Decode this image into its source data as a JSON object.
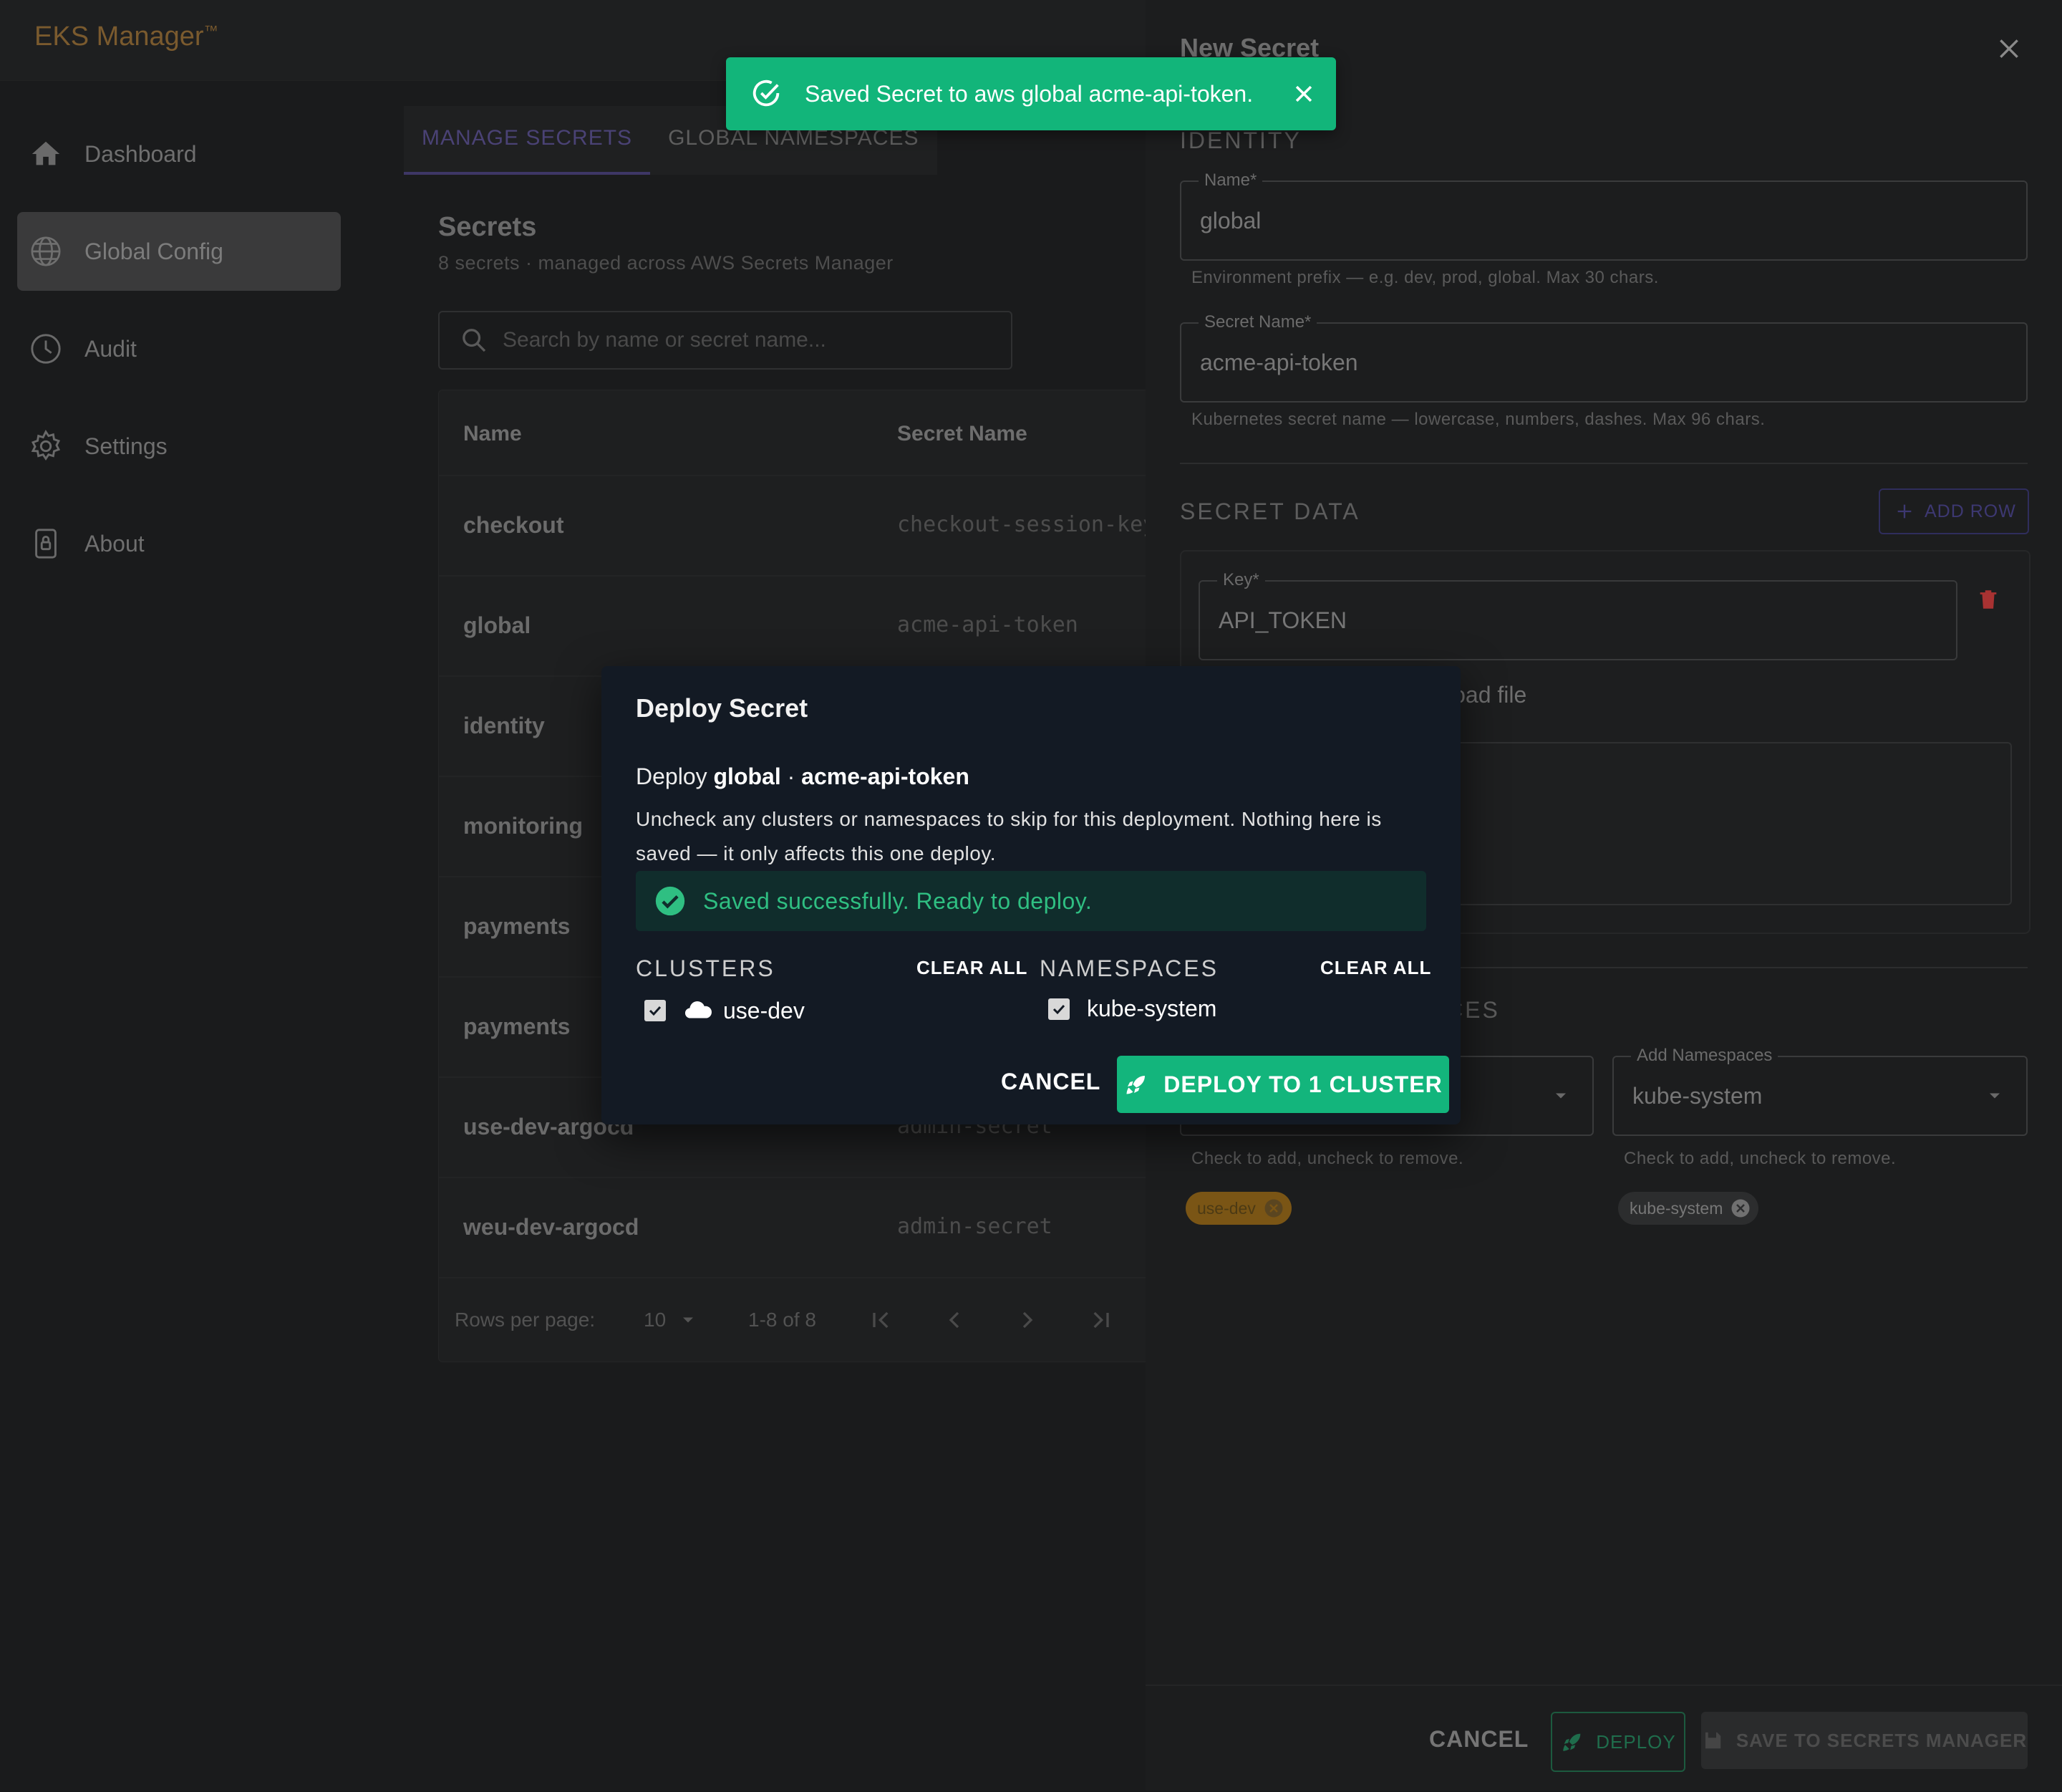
{
  "app": {
    "brand": "EKS Manager",
    "brand_mark": "™"
  },
  "sidebar": {
    "items": [
      {
        "label": "Dashboard",
        "icon": "home-icon"
      },
      {
        "label": "Global Config",
        "icon": "globe-icon",
        "active": true
      },
      {
        "label": "Audit",
        "icon": "clock-icon"
      },
      {
        "label": "Settings",
        "icon": "gear-icon"
      },
      {
        "label": "About",
        "icon": "lock-icon"
      }
    ]
  },
  "tabs": [
    {
      "label": "MANAGE SECRETS",
      "active": true
    },
    {
      "label": "GLOBAL NAMESPACES"
    }
  ],
  "secrets": {
    "title": "Secrets",
    "subtitle": "8 secrets · managed across AWS Secrets Manager",
    "search_placeholder": "Search by name or secret name...",
    "columns": [
      "Name",
      "Secret Name"
    ],
    "rows": [
      {
        "name": "checkout",
        "secret": "checkout-session-key"
      },
      {
        "name": "global",
        "secret": "acme-api-token"
      },
      {
        "name": "identity",
        "secret": ""
      },
      {
        "name": "monitoring",
        "secret": ""
      },
      {
        "name": "payments",
        "secret": ""
      },
      {
        "name": "payments",
        "secret": ""
      },
      {
        "name": "use-dev-argocd",
        "secret": "admin-secret"
      },
      {
        "name": "weu-dev-argocd",
        "secret": "admin-secret"
      }
    ],
    "footer": {
      "rows_per_page_label": "Rows per page:",
      "rows_per_page": "10",
      "range": "1-8 of 8"
    }
  },
  "drawer": {
    "title": "New Secret",
    "identity_heading": "IDENTITY",
    "name_label": "Name*",
    "name_value": "global",
    "name_helper": "Environment prefix — e.g. dev, prod, global. Max 30 chars.",
    "secret_name_label": "Secret Name*",
    "secret_name_value": "acme-api-token",
    "secret_name_helper": "Kubernetes secret name — lowercase, numbers, dashes. Max 96 chars.",
    "secret_data_heading": "SECRET DATA",
    "add_row_label": "ADD ROW",
    "key_label": "Key*",
    "key_value": "API_TOKEN",
    "upload_label_partial": "load file",
    "targets_heading_partial": "CES",
    "add_namespaces_label": "Add Namespaces",
    "add_namespaces_value": "kube-system",
    "clusters_helper": "Check to add, uncheck to remove.",
    "namespaces_helper": "Check to add, uncheck to remove.",
    "cluster_chip": "use-dev",
    "namespace_chip": "kube-system",
    "cancel_label": "CANCEL",
    "deploy_label": "DEPLOY",
    "save_label": "SAVE TO SECRETS MANAGER"
  },
  "toast": {
    "message": "Saved Secret to aws global acme-api-token.",
    "color": "#12b57a"
  },
  "dialog": {
    "title": "Deploy Secret",
    "deploy_prefix": "Deploy",
    "deploy_env": "global",
    "deploy_sep": "·",
    "deploy_secret": "acme-api-token",
    "description": "Uncheck any clusters or namespaces to skip for this deployment. Nothing here is saved — it only affects this one deploy.",
    "alert": "Saved successfully. Ready to deploy.",
    "clusters_heading": "CLUSTERS",
    "namespaces_heading": "NAMESPACES",
    "clear_all_clusters": "CLEAR ALL",
    "clear_all_namespaces": "CLEAR ALL",
    "cluster_item": "use-dev",
    "namespace_item": "kube-system",
    "cancel_label": "CANCEL",
    "deploy_button": "DEPLOY TO 1 CLUSTER",
    "accent": "#13b57c"
  }
}
